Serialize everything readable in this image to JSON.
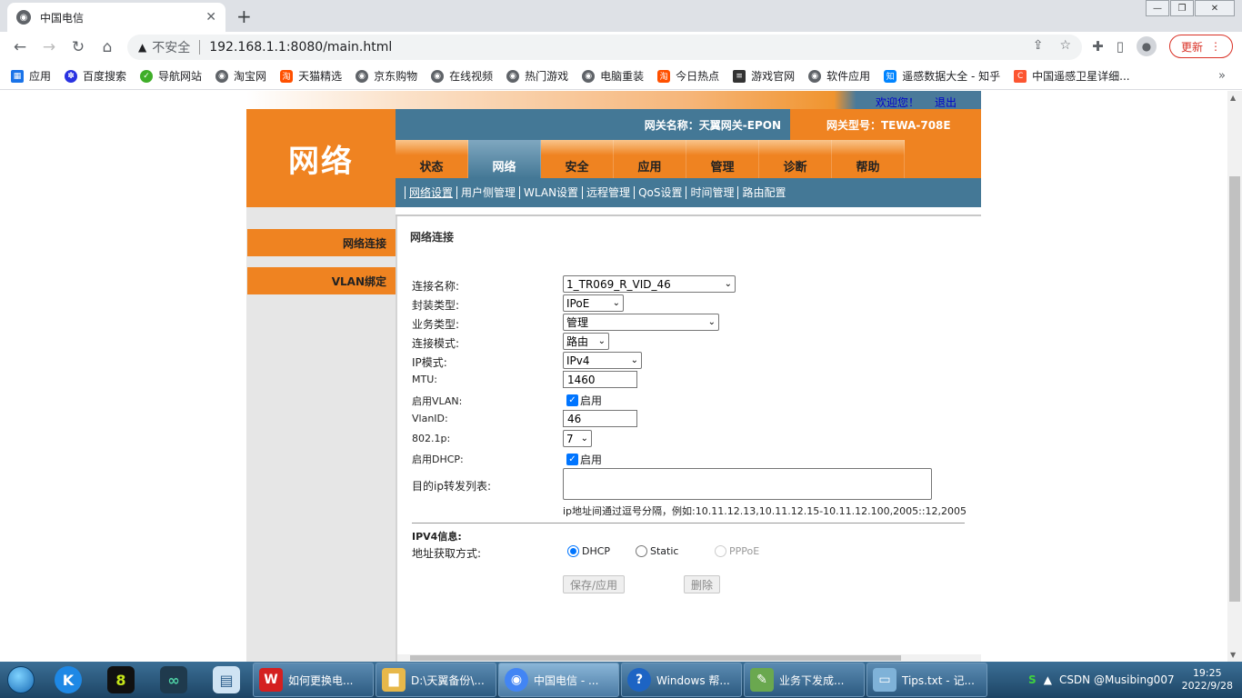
{
  "browser": {
    "tab_title": "中国电信",
    "tab_favicon": "globe-icon",
    "address": {
      "security_label": "不安全",
      "url": "192.168.1.1:8080/main.html"
    },
    "update_label": "更新"
  },
  "bookmarks": [
    {
      "label": "应用",
      "icon": "apps-grid-icon",
      "color": "#1a73e8"
    },
    {
      "label": "百度搜索",
      "icon": "baidu-paw-icon",
      "color": "#2932e1"
    },
    {
      "label": "导航网站",
      "icon": "hao123-icon",
      "color": "#3fae29"
    },
    {
      "label": "淘宝网",
      "icon": "globe-icon",
      "color": "#5f6368"
    },
    {
      "label": "天猫精选",
      "icon": "tao-icon",
      "color": "#ff5000"
    },
    {
      "label": "京东购物",
      "icon": "globe-icon",
      "color": "#5f6368"
    },
    {
      "label": "在线视频",
      "icon": "globe-icon",
      "color": "#5f6368"
    },
    {
      "label": "热门游戏",
      "icon": "globe-icon",
      "color": "#5f6368"
    },
    {
      "label": "电脑重装",
      "icon": "globe-icon",
      "color": "#5f6368"
    },
    {
      "label": "今日热点",
      "icon": "tao-icon",
      "color": "#ff5000"
    },
    {
      "label": "游戏官网",
      "icon": "list-icon",
      "color": "#333333"
    },
    {
      "label": "软件应用",
      "icon": "globe-icon",
      "color": "#5f6368"
    },
    {
      "label": "遥感数据大全 - 知乎",
      "icon": "zhihu-icon",
      "color": "#0084ff"
    },
    {
      "label": "中国遥感卫星详细...",
      "icon": "csdn-icon",
      "color": "#fc5531"
    }
  ],
  "router": {
    "welcome": "欢迎您！",
    "logout": "退出",
    "logo": "网络",
    "gateway_name": "网关名称：天翼网关-EPON",
    "gateway_model": "网关型号：TEWA-708E",
    "menu": [
      "状态",
      "网络",
      "安全",
      "应用",
      "管理",
      "诊断",
      "帮助"
    ],
    "menu_active": "网络",
    "submenu": [
      "网络设置",
      "用户侧管理",
      "WLAN设置",
      "远程管理",
      "QoS设置",
      "时间管理",
      "路由配置"
    ],
    "side": [
      "网络连接",
      "VLAN绑定"
    ],
    "heading": "网络连接",
    "form": {
      "conn_name": {
        "label": "连接名称:",
        "value": "1_TR069_R_VID_46"
      },
      "encap": {
        "label": "封装类型:",
        "value": "IPoE"
      },
      "service": {
        "label": "业务类型:",
        "value": "管理"
      },
      "mode": {
        "label": "连接模式:",
        "value": "路由"
      },
      "ipmode": {
        "label": "IP模式:",
        "value": "IPv4"
      },
      "mtu": {
        "label": "MTU:",
        "value": "1460"
      },
      "vlan_enable": {
        "label": "启用VLAN:",
        "value": "启用"
      },
      "vlanid": {
        "label": "VlanID:",
        "value": "46"
      },
      "dot1p": {
        "label": "802.1p:",
        "value": "7"
      },
      "dhcp_enable": {
        "label": "启用DHCP:",
        "value": "启用"
      },
      "iplist": {
        "label": "目的ip转发列表:",
        "hint": "ip地址间通过逗号分隔，例如:10.11.12.13,10.11.12.15-10.11.12.100,2005::12,2005"
      },
      "ipv4_title": "IPV4信息:",
      "addr_method": {
        "label": "地址获取方式:",
        "options": [
          "DHCP",
          "Static",
          "PPPoE"
        ],
        "selected": "DHCP"
      },
      "save_label": "保存/应用",
      "delete_label": "删除"
    }
  },
  "taskbar": {
    "tasks": [
      {
        "label": "如何更换电...",
        "icon": "wps-icon",
        "color": "#d42020"
      },
      {
        "label": "D:\\天翼备份\\...",
        "icon": "folder-icon",
        "color": "#e7b84a"
      },
      {
        "label": "中国电信 - ...",
        "icon": "chrome-icon",
        "color": "#4285f4"
      },
      {
        "label": "Windows 帮...",
        "icon": "help-icon",
        "color": "#1d64c4"
      },
      {
        "label": "业务下发成...",
        "icon": "paint-icon",
        "color": "#6aa84f"
      },
      {
        "label": "Tips.txt - 记...",
        "icon": "notepad-icon",
        "color": "#7fb2d8"
      }
    ],
    "tray_text": "CSDN @Musibing007",
    "time": "19:25",
    "date": "2022/9/28"
  }
}
